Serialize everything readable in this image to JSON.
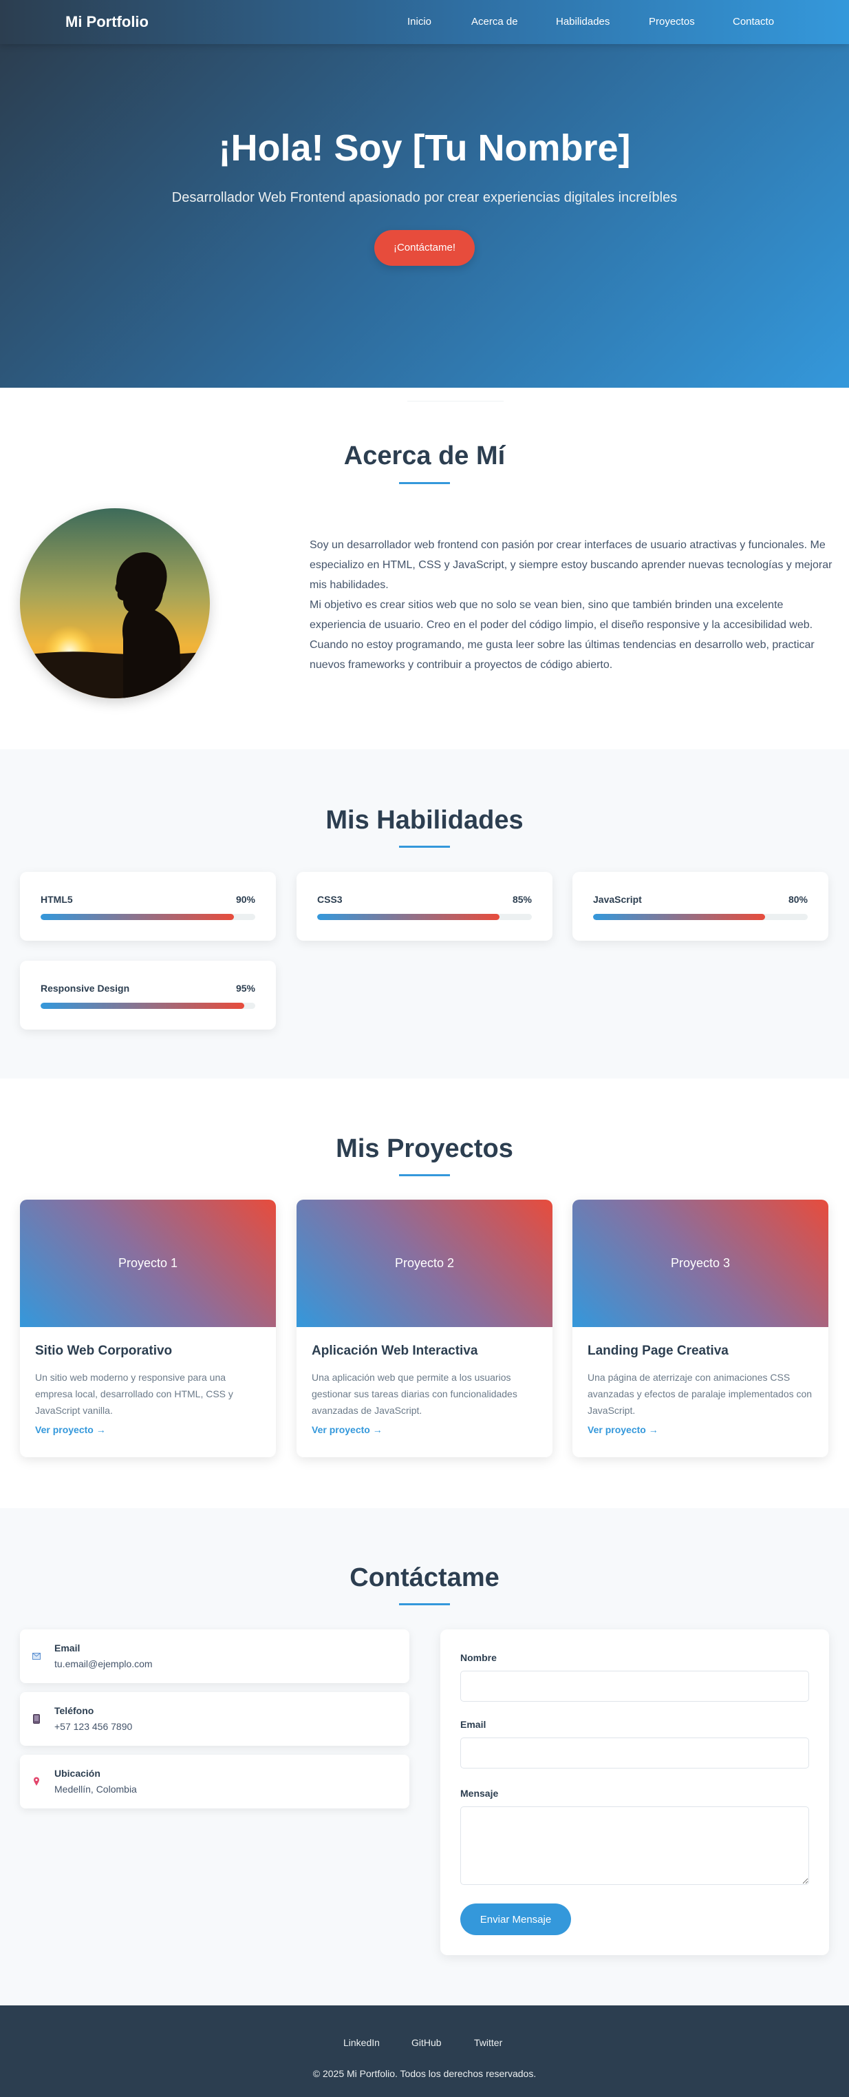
{
  "nav": {
    "brand": "Mi Portfolio",
    "links": [
      "Inicio",
      "Acerca de",
      "Habilidades",
      "Proyectos",
      "Contacto"
    ]
  },
  "hero": {
    "title": "¡Hola! Soy [Tu Nombre]",
    "subtitle": "Desarrollador Web Frontend apasionado por crear experiencias digitales increíbles",
    "button": "¡Contáctame!"
  },
  "about": {
    "title": "Acerca de Mí",
    "paragraphs": [
      "Soy un desarrollador web frontend con pasión por crear interfaces de usuario atractivas y funcionales. Me especializo en HTML, CSS y JavaScript, y siempre estoy buscando aprender nuevas tecnologías y mejorar mis habilidades.",
      "Mi objetivo es crear sitios web que no solo se vean bien, sino que también brinden una excelente experiencia de usuario. Creo en el poder del código limpio, el diseño responsive y la accesibilidad web. Cuando no estoy programando, me gusta leer sobre las últimas tendencias en desarrollo web, practicar nuevos frameworks y contribuir a proyectos de código abierto."
    ]
  },
  "skills": {
    "title": "Mis Habilidades",
    "items": [
      {
        "name": "HTML5",
        "percent_label": "90%",
        "level": 0.9
      },
      {
        "name": "CSS3",
        "percent_label": "85%",
        "level": 0.85
      },
      {
        "name": "JavaScript",
        "percent_label": "80%",
        "level": 0.8
      },
      {
        "name": "Responsive Design",
        "percent_label": "95%",
        "level": 0.95
      }
    ]
  },
  "projects": {
    "title": "Mis Proyectos",
    "items": [
      {
        "image_label": "Proyecto 1",
        "title": "Sitio Web Corporativo",
        "description": "Un sitio web moderno y responsive para una empresa local, desarrollado con HTML, CSS y JavaScript vanilla.",
        "link": "Ver proyecto →"
      },
      {
        "image_label": "Proyecto 2",
        "title": "Aplicación Web Interactiva",
        "description": "Una aplicación web que permite a los usuarios gestionar sus tareas diarias con funcionalidades avanzadas de JavaScript.",
        "link": "Ver proyecto →"
      },
      {
        "image_label": "Proyecto 3",
        "title": "Landing Page Creativa",
        "description": "Una página de aterrizaje con animaciones CSS avanzadas y efectos de paralaje implementados con JavaScript.",
        "link": "Ver proyecto →"
      }
    ]
  },
  "contact": {
    "title": "Contáctame",
    "info": [
      {
        "icon": "email-icon",
        "label": "Email",
        "value": "tu.email@ejemplo.com"
      },
      {
        "icon": "phone-icon",
        "label": "Teléfono",
        "value": "+57 123 456 7890"
      },
      {
        "icon": "location-pin-icon",
        "label": "Ubicación",
        "value": "Medellín, Colombia"
      }
    ],
    "form": {
      "name_label": "Nombre",
      "email_label": "Email",
      "message_label": "Mensaje",
      "submit": "Enviar Mensaje"
    }
  },
  "footer": {
    "links": [
      "LinkedIn",
      "GitHub",
      "Twitter"
    ],
    "copyright": "© 2025 Mi Portfolio. Todos los derechos reservados."
  },
  "colors": {
    "primary": "#3498db",
    "accent": "#e74c3c",
    "dark": "#2c3e50"
  }
}
